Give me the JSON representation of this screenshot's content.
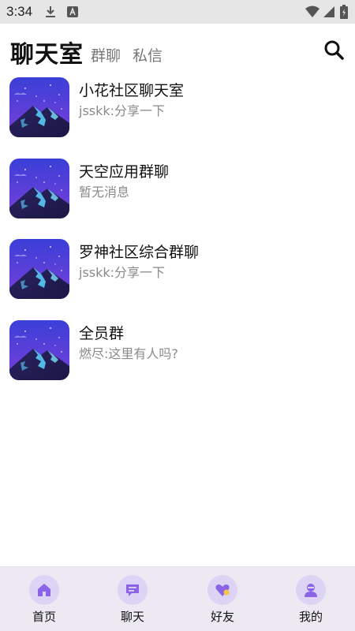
{
  "status_bar": {
    "time": "3:34"
  },
  "header": {
    "title": "聊天室",
    "tabs": [
      {
        "label": "群聊"
      },
      {
        "label": "私信"
      }
    ]
  },
  "chats": [
    {
      "name": "小花社区聊天室",
      "preview": "jsskk:分享一下"
    },
    {
      "name": "天空应用群聊",
      "preview": "暂无消息"
    },
    {
      "name": "罗神社区综合群聊",
      "preview": "jsskk:分享一下"
    },
    {
      "name": "全员群",
      "preview": "燃尽:这里有人吗?"
    }
  ],
  "bottom_nav": {
    "items": [
      {
        "label": "首页",
        "icon": "home-icon"
      },
      {
        "label": "聊天",
        "icon": "chat-icon"
      },
      {
        "label": "好友",
        "icon": "heart-icon"
      },
      {
        "label": "我的",
        "icon": "user-icon"
      }
    ]
  },
  "colors": {
    "accent": "#8a63e6",
    "nav_bg": "#ece9f2",
    "icon_bg": "#dcd3f5"
  }
}
